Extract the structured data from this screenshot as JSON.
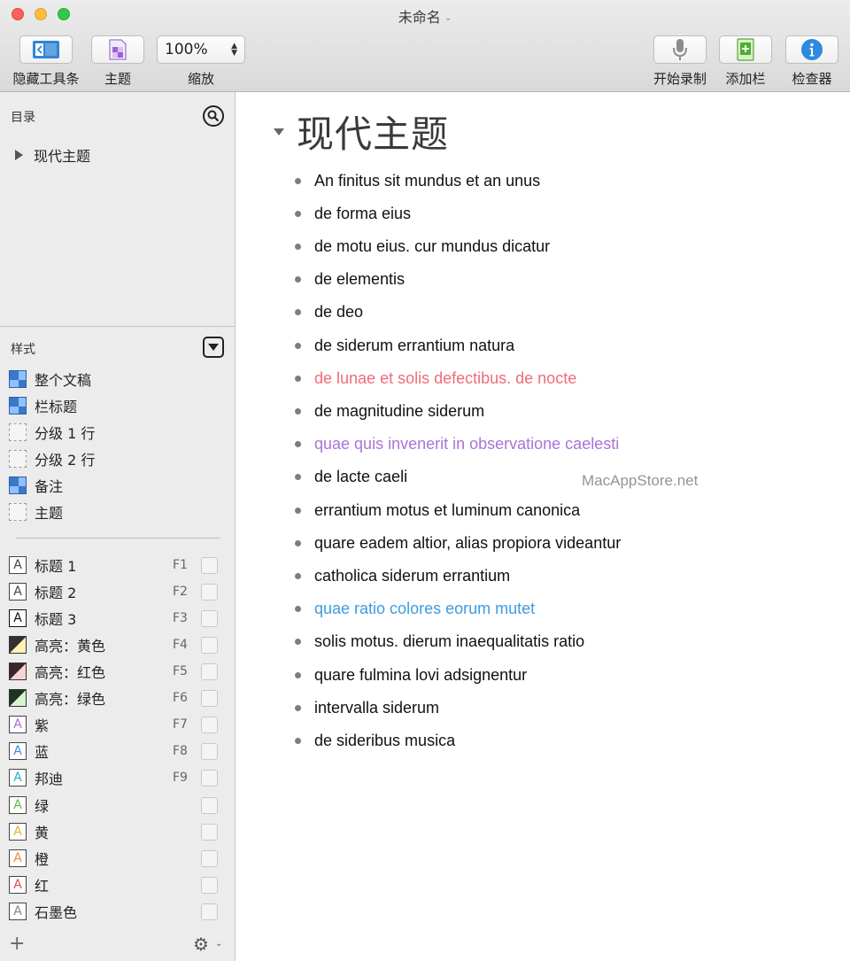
{
  "window": {
    "title": "未命名",
    "title_chevron": "⌄"
  },
  "toolbar": {
    "hide_toolbar_label": "隐藏工具条",
    "theme_label": "主题",
    "zoom_value": "100%",
    "zoom_label": "缩放",
    "record_label": "开始录制",
    "add_column_label": "添加栏",
    "inspector_label": "检查器"
  },
  "sidebar": {
    "toc_header": "目录",
    "toc_items": [
      "现代主题"
    ],
    "styles_header": "样式",
    "doc_styles": [
      {
        "label": "整个文稿",
        "swatch": "blue"
      },
      {
        "label": "栏标题",
        "swatch": "blue"
      },
      {
        "label": "分级 1 行",
        "swatch": "dashed"
      },
      {
        "label": "分级 2 行",
        "swatch": "dashed"
      },
      {
        "label": "备注",
        "swatch": "blue"
      },
      {
        "label": "主题",
        "swatch": "dashed"
      }
    ],
    "named_styles": [
      {
        "label": "标题 1",
        "key": "F1",
        "icon": "A",
        "color": "#444444"
      },
      {
        "label": "标题 2",
        "key": "F2",
        "icon": "A",
        "color": "#444444"
      },
      {
        "label": "标题 3",
        "key": "F3",
        "icon": "A",
        "color": "#111111"
      },
      {
        "label": "高亮：黄色",
        "key": "F4",
        "icon": "highlight",
        "color": "#fff1b8"
      },
      {
        "label": "高亮：红色",
        "key": "F5",
        "icon": "highlight",
        "color": "#f7d3d6"
      },
      {
        "label": "高亮：绿色",
        "key": "F6",
        "icon": "highlight",
        "color": "#d9f2cf"
      },
      {
        "label": "紫",
        "key": "F7",
        "icon": "A",
        "color": "#a56fd6"
      },
      {
        "label": "蓝",
        "key": "F8",
        "icon": "A",
        "color": "#3b8ee3"
      },
      {
        "label": "邦迪",
        "key": "F9",
        "icon": "A",
        "color": "#1fb6c8"
      },
      {
        "label": "绿",
        "key": "",
        "icon": "A",
        "color": "#5fb84a"
      },
      {
        "label": "黄",
        "key": "",
        "icon": "A",
        "color": "#e4b226"
      },
      {
        "label": "橙",
        "key": "",
        "icon": "A",
        "color": "#ee8a3a"
      },
      {
        "label": "红",
        "key": "",
        "icon": "A",
        "color": "#e5485b"
      },
      {
        "label": "石墨色",
        "key": "",
        "icon": "A",
        "color": "#7a8896"
      }
    ],
    "add_symbol": "+",
    "gear_symbol": "⚙",
    "gear_chevron": "⌄"
  },
  "document": {
    "heading": "现代主题",
    "rows": [
      {
        "text": "An finitus sit mundus et an unus",
        "color": "#111111"
      },
      {
        "text": "de forma eius",
        "color": "#111111"
      },
      {
        "text": "de motu eius. cur mundus dicatur",
        "color": "#111111"
      },
      {
        "text": "de elementis",
        "color": "#111111"
      },
      {
        "text": "de deo",
        "color": "#111111"
      },
      {
        "text": "de siderum errantium natura",
        "color": "#111111"
      },
      {
        "text": "de lunae et solis defectibus. de nocte",
        "color": "#ef6b7b"
      },
      {
        "text": "de magnitudine siderum",
        "color": "#111111"
      },
      {
        "text": "quae quis invenerit in observatione caelesti",
        "color": "#a974d8"
      },
      {
        "text": "de lacte caeli",
        "color": "#111111"
      },
      {
        "text": "errantium motus et luminum canonica",
        "color": "#111111"
      },
      {
        "text": "quare eadem altior, alias propiora videantur",
        "color": "#111111"
      },
      {
        "text": "catholica siderum errantium",
        "color": "#111111"
      },
      {
        "text": "quae ratio colores eorum mutet",
        "color": "#3d9be0"
      },
      {
        "text": "solis motus. dierum inaequalitatis ratio",
        "color": "#111111"
      },
      {
        "text": "quare fulmina lovi adsignentur",
        "color": "#111111"
      },
      {
        "text": "intervalla siderum",
        "color": "#111111"
      },
      {
        "text": "de sideribus musica",
        "color": "#111111"
      }
    ],
    "watermark": "MacAppStore.net"
  }
}
